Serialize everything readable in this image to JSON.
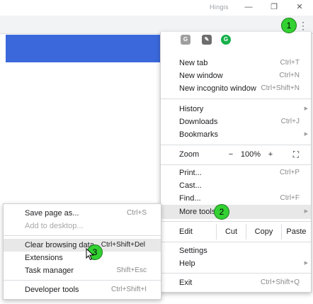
{
  "window": {
    "title": "Hingis",
    "minimize_glyph": "—",
    "restore_glyph": "❐",
    "close_glyph": "✕"
  },
  "toolbar": {
    "menu_icon": "⋮"
  },
  "extensions": [
    {
      "name": "grammarly-g-icon",
      "glyph": "G",
      "color": "#9e9e9e"
    },
    {
      "name": "notes-icon",
      "glyph": "✎",
      "color": "#6d6d6d"
    },
    {
      "name": "grammarly-icon",
      "glyph": "G",
      "color": "#14b04a"
    }
  ],
  "menu": {
    "new_tab": {
      "label": "New tab",
      "shortcut": "Ctrl+T"
    },
    "new_window": {
      "label": "New window",
      "shortcut": "Ctrl+N"
    },
    "new_incognito": {
      "label": "New incognito window",
      "shortcut": "Ctrl+Shift+N"
    },
    "history": {
      "label": "History"
    },
    "downloads": {
      "label": "Downloads",
      "shortcut": "Ctrl+J"
    },
    "bookmarks": {
      "label": "Bookmarks"
    },
    "zoom": {
      "label": "Zoom",
      "minus": "−",
      "value": "100%",
      "plus": "+",
      "fullscreen": "⛶"
    },
    "print": {
      "label": "Print...",
      "shortcut": "Ctrl+P"
    },
    "cast": {
      "label": "Cast..."
    },
    "find": {
      "label": "Find...",
      "shortcut": "Ctrl+F"
    },
    "more_tools": {
      "label": "More tools"
    },
    "edit": {
      "label": "Edit",
      "cut": "Cut",
      "copy": "Copy",
      "paste": "Paste"
    },
    "settings": {
      "label": "Settings"
    },
    "help": {
      "label": "Help"
    },
    "exit": {
      "label": "Exit",
      "shortcut": "Ctrl+Shift+Q"
    }
  },
  "submenu": {
    "save_page": {
      "label": "Save page as...",
      "shortcut": "Ctrl+S"
    },
    "add_desktop": {
      "label": "Add to desktop..."
    },
    "clear_browsing": {
      "label": "Clear browsing data...",
      "shortcut": "Ctrl+Shift+Del"
    },
    "extensions": {
      "label": "Extensions"
    },
    "task_manager": {
      "label": "Task manager",
      "shortcut": "Shift+Esc"
    },
    "developer_tools": {
      "label": "Developer tools",
      "shortcut": "Ctrl+Shift+I"
    }
  },
  "markers": {
    "one": "1",
    "two": "2",
    "three": "3"
  },
  "colors": {
    "marker": "#33d132",
    "banner": "#3b69db",
    "highlight": "#e8e8e8"
  }
}
